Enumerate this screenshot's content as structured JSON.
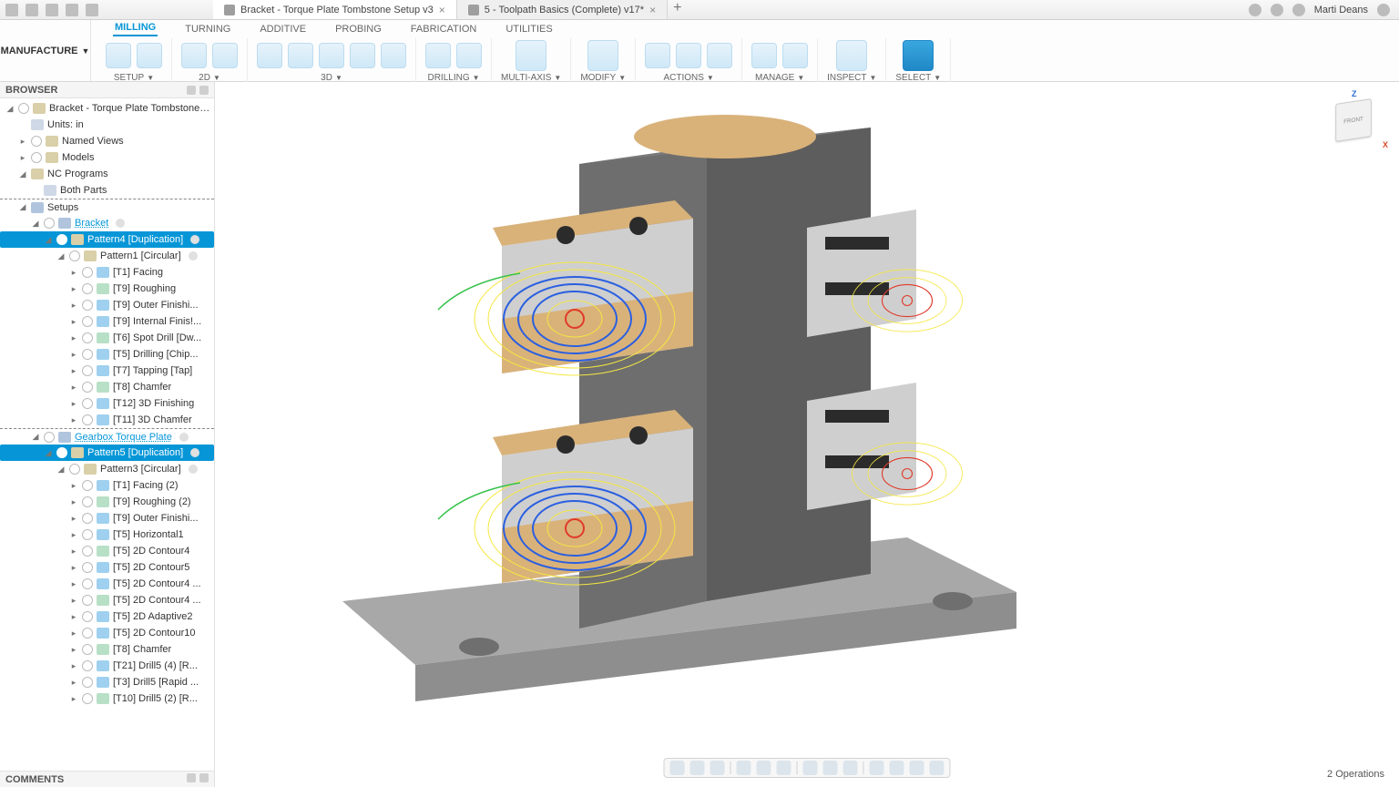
{
  "titlebar": {
    "quick_access_icons": [
      "grid",
      "file",
      "panel",
      "undo",
      "redo"
    ],
    "tabs": [
      {
        "title": "Bracket - Torque Plate Tombstone Setup v3",
        "icon": "assembly",
        "active": true,
        "dirty": false
      },
      {
        "title": "5 - Toolpath Basics (Complete) v17*",
        "icon": "part",
        "active": false,
        "dirty": true
      }
    ],
    "user_name": "Marti Deans",
    "right_icons": [
      "extensions",
      "jobstatus",
      "notifications",
      "help"
    ]
  },
  "workspace": {
    "label": "MANUFACTURE"
  },
  "ribbon": {
    "tabs": [
      "MILLING",
      "TURNING",
      "ADDITIVE",
      "PROBING",
      "FABRICATION",
      "UTILITIES"
    ],
    "active_tab": "MILLING",
    "groups": [
      {
        "label": "SETUP",
        "caret": true,
        "icon_count": 2
      },
      {
        "label": "2D",
        "caret": true,
        "icon_count": 2
      },
      {
        "label": "3D",
        "caret": true,
        "icon_count": 5
      },
      {
        "label": "DRILLING",
        "caret": true,
        "icon_count": 2
      },
      {
        "label": "MULTI-AXIS",
        "caret": true,
        "icon_count": 1
      },
      {
        "label": "MODIFY",
        "caret": true,
        "icon_count": 1
      },
      {
        "label": "ACTIONS",
        "caret": true,
        "icon_count": 3
      },
      {
        "label": "MANAGE",
        "caret": true,
        "icon_count": 2
      },
      {
        "label": "INSPECT",
        "caret": true,
        "icon_count": 1
      },
      {
        "label": "SELECT",
        "caret": true,
        "icon_count": 1,
        "selected": true
      }
    ]
  },
  "browser": {
    "title": "BROWSER",
    "root": "Bracket - Torque Plate Tombstone ...",
    "units": "Units: in",
    "named_views": "Named Views",
    "models": "Models",
    "nc_programs": "NC Programs",
    "nc_item": "Both Parts",
    "setups_label": "Setups",
    "setups": [
      {
        "name": "Bracket",
        "patterns": [
          {
            "name": "Pattern4 [Duplication]",
            "selected": true,
            "children": [
              {
                "name": "Pattern1 [Circular]",
                "selected": false,
                "ops": [
                  "[T1] Facing",
                  "[T9] Roughing",
                  "[T9] Outer Finishi...",
                  "[T9] Internal Finis!...",
                  "[T6] Spot Drill [Dw...",
                  "[T5] Drilling [Chip...",
                  "[T7] Tapping [Tap]",
                  "[T8] Chamfer",
                  "[T12] 3D Finishing",
                  "[T11] 3D Chamfer"
                ]
              }
            ]
          }
        ]
      },
      {
        "name": "Gearbox Torque Plate",
        "patterns": [
          {
            "name": "Pattern5 [Duplication]",
            "selected": true,
            "children": [
              {
                "name": "Pattern3 [Circular]",
                "selected": false,
                "ops": [
                  "[T1] Facing (2)",
                  "[T9] Roughing (2)",
                  "[T9] Outer Finishi...",
                  "[T5] Horizontal1",
                  "[T5] 2D Contour4",
                  "[T5] 2D Contour5",
                  "[T5] 2D Contour4 ...",
                  "[T5] 2D Contour4 ...",
                  "[T5] 2D Adaptive2",
                  "[T5] 2D Contour10",
                  "[T8] Chamfer",
                  "[T21] Drill5 (4) [R...",
                  "[T3] Drill5 [Rapid ...",
                  "[T10] Drill5 (2) [R..."
                ]
              }
            ]
          }
        ]
      }
    ]
  },
  "comments": {
    "title": "COMMENTS"
  },
  "viewcube": {
    "face": "FRONT",
    "axis_z": "Z",
    "axis_x": "X"
  },
  "statusbar": {
    "text": "2 Operations"
  },
  "navbar": {
    "icon_count": 13
  },
  "colors": {
    "accent": "#0696d7",
    "toolpath_yellow": "#f5e742",
    "toolpath_blue": "#2a5fe0",
    "toolpath_green": "#35c24a",
    "toolpath_red": "#e03a2a",
    "fixture_tan": "#d9b27a",
    "fixture_dark": "#5d5d5d",
    "fixture_light": "#cfcfcf",
    "base_plate": "#8e8e8e"
  }
}
